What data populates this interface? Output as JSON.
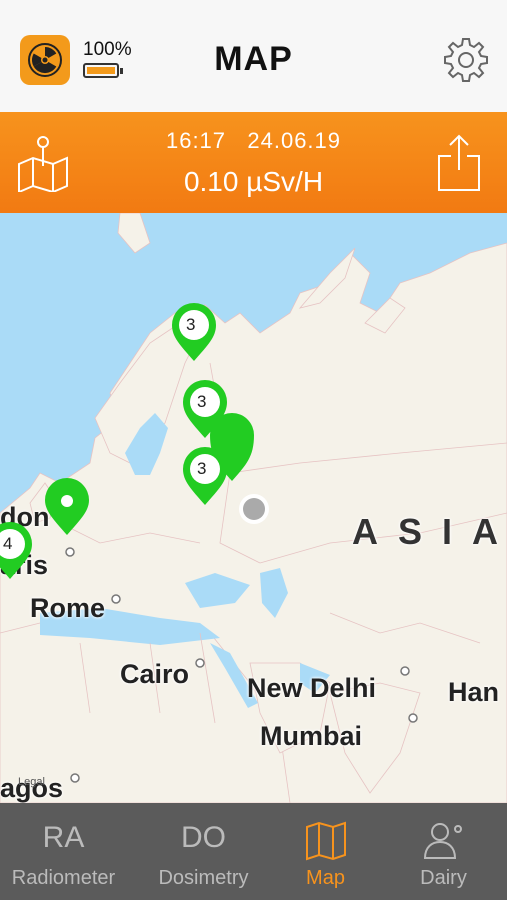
{
  "header": {
    "title": "MAP",
    "battery_percent": "100%",
    "battery_level": 1.0,
    "app_icon": "radiation-icon",
    "settings_icon": "gear-icon"
  },
  "status_bar": {
    "time": "16:17",
    "date": "24.06.19",
    "dose_rate": "0.10 µSv/H",
    "left_icon": "map-pin-icon",
    "right_icon": "share-icon"
  },
  "map": {
    "labels": [
      "ASIA",
      "Rome",
      "Cairo",
      "New Delhi",
      "Mumbai",
      "don",
      "aris",
      "Han",
      "agos"
    ],
    "markers": [
      {
        "count": "3",
        "color": "#22cc22"
      },
      {
        "count": "3",
        "color": "#22cc22"
      },
      {
        "count": "3",
        "color": "#22cc22"
      },
      {
        "count": "4",
        "color": "#22cc22"
      }
    ],
    "legal": "Legal"
  },
  "tabs": [
    {
      "abbr": "RA",
      "label": "Radiometer"
    },
    {
      "abbr": "DO",
      "label": "Dosimetry"
    },
    {
      "abbr": "",
      "label": "Map",
      "icon": "map-icon"
    },
    {
      "abbr": "",
      "label": "Dairy",
      "icon": "person-icon"
    }
  ],
  "colors": {
    "accent": "#f7931d",
    "marker": "#22cc22",
    "water": "#aadbf7",
    "land": "#f5f2e9"
  }
}
